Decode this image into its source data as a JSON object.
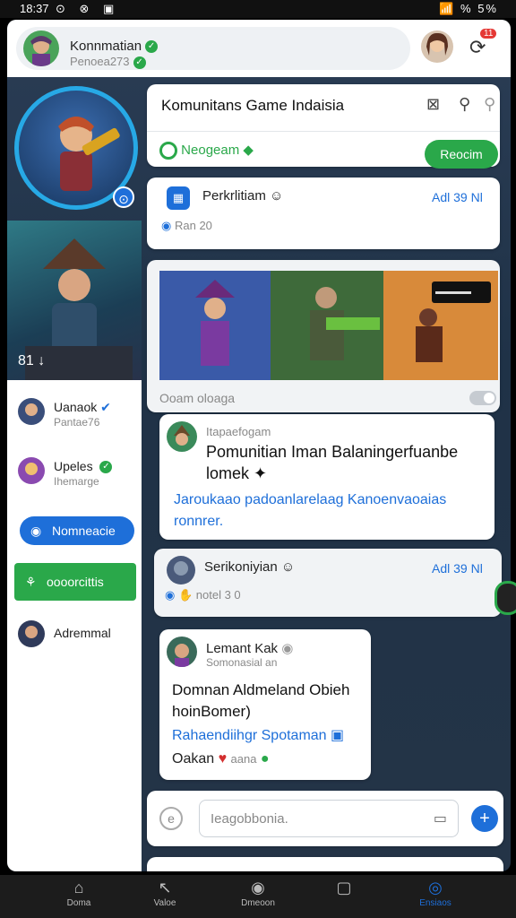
{
  "status_bar": {
    "time": "18:37",
    "icons": "⊙ ⊗ ▣",
    "right": "📶 % 5%"
  },
  "header": {
    "user_name": "Konnmatian",
    "user_sub": "Penoea273",
    "notification_count": "11"
  },
  "sidebar": {
    "hero_badge": "⊙",
    "hero_caption": "81 ↓",
    "items": [
      {
        "name": "Uanaok",
        "sub": "Pantae76"
      },
      {
        "name": "Upeles",
        "sub": "Ihemarge"
      },
      {
        "name": "Adremmal",
        "sub": ""
      }
    ],
    "btn_blue": "Nomneacie",
    "btn_green": "oooorcittis"
  },
  "community": {
    "title": "Komunitans Game Indaisia",
    "tag": "Neogeam",
    "join_label": "Reocim"
  },
  "post1": {
    "name": "Perkrlitiam",
    "sub": "Ran",
    "count": "20",
    "badge": "Adl 39 Nl"
  },
  "gallery": {
    "toggle_label": "Ooam oloaga",
    "overlay": "▬▬▬▬"
  },
  "post2": {
    "author": "Itapaefogam",
    "headline": "Pomunitian Iman Balaningerfuanbe lomek",
    "body": "Jaroukaao padoanlarelaag Kanoenvaoaias ronnrer."
  },
  "post3": {
    "name": "Serikoniyian",
    "sub": "notel",
    "count": "3 0",
    "badge": "Adl 39 Nl"
  },
  "post4": {
    "author": "Lemant Kak",
    "sub": "Somonasial an",
    "headline": "Domnan Aldmeland Obieh hoinBomer)",
    "link": "Rahaendiihgr Spotaman",
    "footer": "Oakan",
    "footer2": "aana"
  },
  "composer": {
    "placeholder": "Ieagobbonia."
  },
  "nav": [
    {
      "label": "Doma",
      "icon": "⌂"
    },
    {
      "label": "Valoe",
      "icon": "↖"
    },
    {
      "label": "Dmeoon",
      "icon": "◉"
    },
    {
      "label": "",
      "icon": "▢"
    },
    {
      "label": "Ensiaos",
      "icon": "◎"
    }
  ],
  "colors": {
    "accent": "#1e6fd9",
    "green": "#2aa84a",
    "badge": "#e53935"
  }
}
